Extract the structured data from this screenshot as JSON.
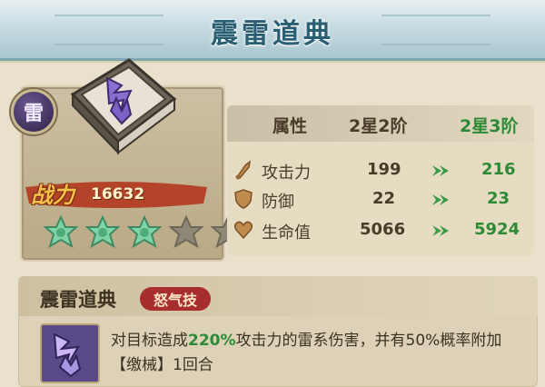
{
  "title": "震雷道典",
  "item": {
    "element": "雷",
    "power_label": "战力",
    "power_value": "16632",
    "stars_total": 5,
    "stars_filled": 3,
    "icon": "lightning-book-icon"
  },
  "stats": {
    "header": {
      "attr": "属性",
      "current": "2星2阶",
      "next": "2星3阶"
    },
    "rows": [
      {
        "name": "攻击力",
        "current": "199",
        "next": "216",
        "icon": "attack-icon"
      },
      {
        "name": "防御",
        "current": "22",
        "next": "23",
        "icon": "defense-icon"
      },
      {
        "name": "生命值",
        "current": "5066",
        "next": "5924",
        "icon": "hp-icon"
      }
    ]
  },
  "skill": {
    "name": "震雷道典",
    "tag": "怒气技",
    "desc_part1": "对目标造成",
    "desc_highlight": "220%",
    "desc_part2": "攻击力的雷系伤害，并有50%概率附加【缴械】1回合"
  },
  "colors": {
    "accent_green": "#2e8a36",
    "tag_red": "#a82e2e",
    "banner_blue": "#2a5f73"
  }
}
